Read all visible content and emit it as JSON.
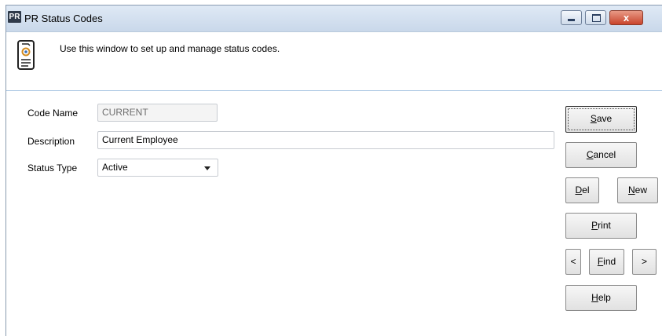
{
  "window": {
    "app_icon_text": "PR",
    "title": "PR Status Codes",
    "controls": {
      "close_glyph": "x"
    }
  },
  "header": {
    "description": "Use this window to set up and manage status codes.",
    "icon": "document-gear-icon"
  },
  "form": {
    "code_name": {
      "label": "Code Name",
      "value": "CURRENT"
    },
    "description": {
      "label": "Description",
      "value": "Current Employee"
    },
    "status_type": {
      "label": "Status Type",
      "value": "Active"
    }
  },
  "buttons": {
    "save": "Save",
    "cancel": "Cancel",
    "del": "Del",
    "new": "New",
    "print": "Print",
    "prev": "<",
    "find": "Find",
    "next": ">",
    "help": "Help"
  },
  "colors": {
    "title_bar": "#c9d8ea",
    "header_divider": "#a7c4e2",
    "close_button": "#c9452c"
  }
}
